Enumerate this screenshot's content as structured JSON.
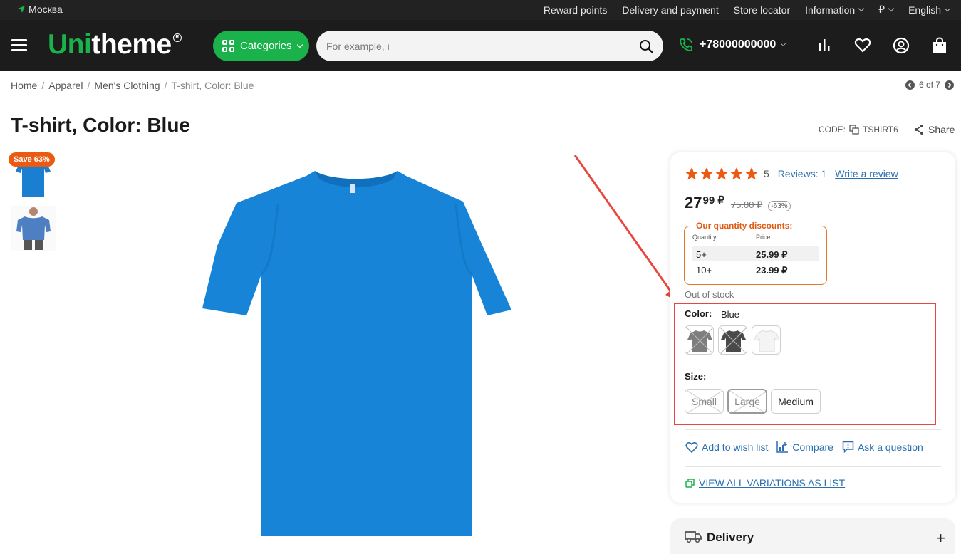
{
  "topbar": {
    "city": "Москва",
    "links": [
      "Reward points",
      "Delivery and payment",
      "Store locator",
      "Information",
      "₽",
      "English"
    ]
  },
  "header": {
    "logo_prefix": "Uni",
    "logo_suffix": "theme",
    "categories_label": "Categories",
    "search_placeholder": "For example, i",
    "phone": "+78000000000",
    "icons": [
      "compare-icon",
      "wishlist-heart-icon",
      "account-icon",
      "cart-bag-icon"
    ],
    "accent_color": "#19b24b"
  },
  "breadcrumb": {
    "items": [
      "Home",
      "Apparel",
      "Men's Clothing"
    ],
    "current": "T-shirt, Color: Blue",
    "pager": "6 of 7"
  },
  "product": {
    "title": "T-shirt, Color: Blue",
    "code_label": "CODE:",
    "code": "TSHIRT6",
    "share_label": "Share",
    "badge": "Save 63%",
    "rating_value": "5",
    "reviews_label": "Reviews: 1",
    "write_review": "Write a review",
    "price_main": "27",
    "price_cents": "99 ₽",
    "price_old": "75.00 ₽",
    "price_discount": "-63%",
    "discounts": {
      "title": "Our quantity discounts:",
      "col_qty": "Quantity",
      "col_price": "Price",
      "rows": [
        {
          "qty": "5+",
          "price": "25.99 ₽"
        },
        {
          "qty": "10+",
          "price": "23.99 ₽"
        }
      ]
    },
    "stock": "Out of stock",
    "color_label": "Color:",
    "color_value": "Blue",
    "size_label": "Size:",
    "sizes": [
      "Small",
      "Large",
      "Medium"
    ],
    "actions": [
      "Add to wish list",
      "Compare",
      "Ask a question"
    ],
    "view_all": "VIEW ALL VARIATIONS AS LIST"
  },
  "delivery": {
    "title": "Delivery",
    "toggle": "+"
  }
}
